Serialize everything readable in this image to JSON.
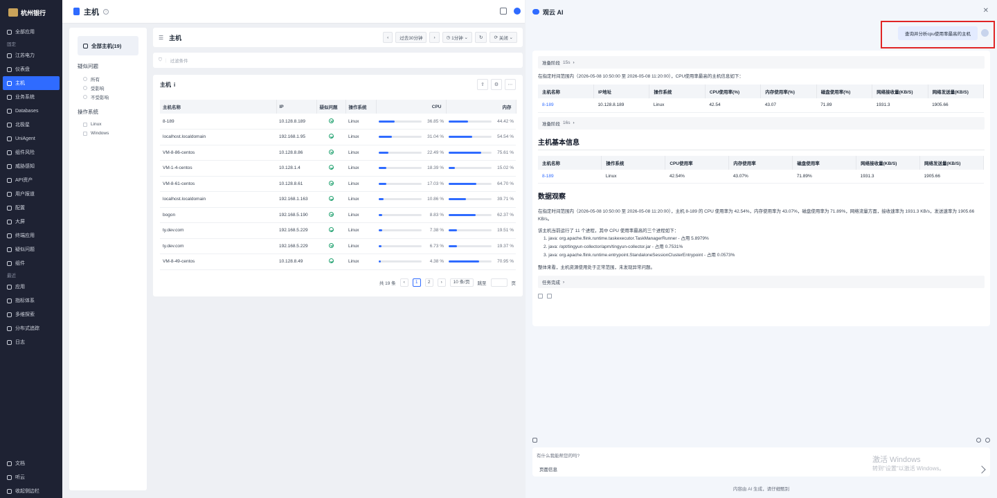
{
  "sidebar": {
    "logo": "杭州银行",
    "all_apps": "全部应用",
    "group_pinned": "固定",
    "pinned_items": [
      {
        "label": "江苏电力",
        "active": false
      },
      {
        "label": "仪表盘",
        "active": false
      },
      {
        "label": "主机",
        "active": true
      },
      {
        "label": "业务系统",
        "active": false
      },
      {
        "label": "Databases",
        "active": false
      },
      {
        "label": "北极星",
        "active": false
      },
      {
        "label": "UniAgent",
        "active": false
      },
      {
        "label": "组件风险",
        "active": false
      },
      {
        "label": "威胁感知",
        "active": false
      },
      {
        "label": "API资产",
        "active": false
      },
      {
        "label": "用户报道",
        "active": false
      },
      {
        "label": "配置",
        "active": false
      },
      {
        "label": "大屏",
        "active": false
      },
      {
        "label": "终端应用",
        "active": false
      },
      {
        "label": "疑似问题",
        "active": false
      },
      {
        "label": "组件",
        "active": false
      }
    ],
    "group_recent": "最近",
    "recent_items": [
      "应用",
      "指标体系",
      "多维探索",
      "分布式追踪",
      "日志"
    ],
    "bottom_items": [
      "文档",
      "听云",
      "收起侧边栏"
    ]
  },
  "topbar": {
    "title": "主机"
  },
  "filter": {
    "all_hosts": "全部主机(19)",
    "problem_title": "疑似问题",
    "problem_options": [
      "所有",
      "受影响",
      "不受影响"
    ],
    "os_title": "操作系统",
    "os_options": [
      "Linux",
      "Windows"
    ]
  },
  "toolbar": {
    "title": "主机",
    "time_range": "过去30分钟",
    "interval": "1分钟",
    "auto_refresh": "关闭"
  },
  "search": {
    "placeholder": "过滤条件"
  },
  "table": {
    "title": "主机",
    "columns": [
      "主机名称",
      "IP",
      "疑似问题",
      "操作系统",
      "CPU",
      "内存"
    ],
    "rows": [
      {
        "name": "8-189",
        "ip": "10.128.8.189",
        "os": "Linux",
        "cpu": "36.85 %",
        "cpu_val": 0.3685,
        "mem": "44.42 %",
        "mem_val": 0.4442
      },
      {
        "name": "localhost.localdomain",
        "ip": "192.168.1.95",
        "os": "Linux",
        "cpu": "31.04 %",
        "cpu_val": 0.3104,
        "mem": "54.54 %",
        "mem_val": 0.5454
      },
      {
        "name": "VM-8-86-centos",
        "ip": "10.128.8.86",
        "os": "Linux",
        "cpu": "22.49 %",
        "cpu_val": 0.2249,
        "mem": "75.61 %",
        "mem_val": 0.7561
      },
      {
        "name": "VM-1-4-centos",
        "ip": "10.128.1.4",
        "os": "Linux",
        "cpu": "18.39 %",
        "cpu_val": 0.1839,
        "mem": "15.02 %",
        "mem_val": 0.1502
      },
      {
        "name": "VM-8-61-centos",
        "ip": "10.128.8.61",
        "os": "Linux",
        "cpu": "17.03 %",
        "cpu_val": 0.1703,
        "mem": "64.70 %",
        "mem_val": 0.647
      },
      {
        "name": "localhost.localdomain",
        "ip": "192.168.1.163",
        "os": "Linux",
        "cpu": "10.86 %",
        "cpu_val": 0.1086,
        "mem": "39.71 %",
        "mem_val": 0.3971
      },
      {
        "name": "bogon",
        "ip": "192.168.5.190",
        "os": "Linux",
        "cpu": "8.83 %",
        "cpu_val": 0.0883,
        "mem": "62.37 %",
        "mem_val": 0.6237
      },
      {
        "name": "ty.dev.com",
        "ip": "192.168.5.229",
        "os": "Linux",
        "cpu": "7.38 %",
        "cpu_val": 0.0738,
        "mem": "19.51 %",
        "mem_val": 0.1951
      },
      {
        "name": "ty.dev.com",
        "ip": "192.168.5.229",
        "os": "Linux",
        "cpu": "6.73 %",
        "cpu_val": 0.0673,
        "mem": "19.37 %",
        "mem_val": 0.1937
      },
      {
        "name": "VM-8-49-centos",
        "ip": "10.128.8.49",
        "os": "Linux",
        "cpu": "4.38 %",
        "cpu_val": 0.0438,
        "mem": "70.95 %",
        "mem_val": 0.7095
      }
    ],
    "pager": {
      "total": "共 19 条",
      "page1": "1",
      "page2": "2",
      "page_size": "10 条/页",
      "goto": "跳至",
      "page_unit": "页"
    }
  },
  "ai": {
    "title": "观云 AI",
    "user_query": "查询并分析cpu使用率最高的主机",
    "step1": {
      "label": "准备阶段",
      "time": "15s"
    },
    "intro": "在指定时间范围内（2026-05-08 10:50:00 至 2026-05-08 11:20:00），CPU使用率最高的主机信息如下：",
    "table1": {
      "columns": [
        "主机名称",
        "IP地址",
        "操作系统",
        "CPU使用率(%)",
        "内存使用率(%)",
        "磁盘使用率(%)",
        "网络接收量(KB/S)",
        "网络发送量(KB/S)"
      ],
      "row": [
        "8-189",
        "10.128.8.189",
        "Linux",
        "42.54",
        "43.07",
        "71.89",
        "1931.3",
        "1905.66"
      ]
    },
    "step2": {
      "label": "准备阶段",
      "time": "16s"
    },
    "section1": "主机基本信息",
    "table2": {
      "columns": [
        "主机名称",
        "操作系统",
        "CPU使用率",
        "内存使用率",
        "磁盘使用率",
        "网络接收量(KB/S)",
        "网络发送量(KB/S)"
      ],
      "row": [
        "8-189",
        "Linux",
        "42.54%",
        "43.07%",
        "71.89%",
        "1931.3",
        "1905.66"
      ]
    },
    "section2": "数据观察",
    "obs_para": "在指定时间范围内（2026-05-08 10:50:00 至 2026-05-08 11:20:00），主机 8-189 的 CPU 使用率为 42.54%，内存使用率为 43.07%，磁盘使用率为 71.89%，网络流量方面，接收速率为 1931.3 KB/s，发送速率为 1905.66 KB/s。",
    "proc_intro": "该主机当前运行了 11 个进程，其中 CPU 使用率最高的三个进程如下：",
    "procs": [
      "1. java: org.apache.flink.runtime.taskexecutor.TaskManagerRunner - 占用 5.8979%",
      "2. java: /opt/tingyun-collector/apm/tingyun-collector.jar - 占用 0.7531%",
      "3. java: org.apache.flink.runtime.entrypoint.StandaloneSessionClusterEntrypoint - 占用 0.0573%"
    ],
    "summary": "整体来看，主机资源使用处于正常范围，未发现异常问题。",
    "step3": {
      "label": "任务完成"
    },
    "input_placeholder": "有什么我能帮您的吗?",
    "page_info": "页面信息",
    "watermark_title": "激活 Windows",
    "watermark_sub": "转到\"设置\"以激活 Windows。",
    "footer": "内容由 AI 生成，请仔细甄别"
  },
  "colors": {
    "accent": "#2f6bff",
    "sidebar_bg": "#1e2233",
    "highlight": "#e02424"
  }
}
